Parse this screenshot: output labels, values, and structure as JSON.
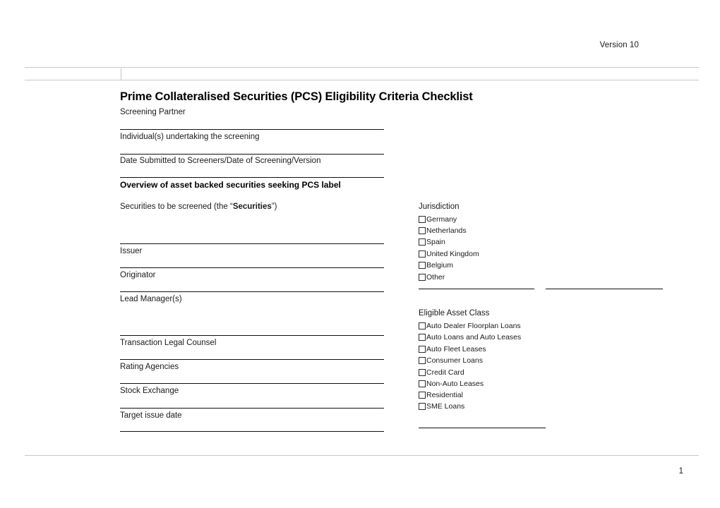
{
  "header": {
    "version": "Version 10",
    "table_cell_left": "",
    "table_cell_right": ""
  },
  "title": {
    "main": "Prime Collateralised Securities (PCS) Eligibility Criteria Checklist",
    "sub": "Screening Partner"
  },
  "left_fields": [
    {
      "label": "Individual(s) undertaking the screening",
      "bold": false
    },
    {
      "label": "Date Submitted to Screeners/Date of Screening/Version",
      "bold": false
    },
    {
      "label": "Overview of asset backed securities seeking PCS label",
      "bold": true
    },
    {
      "label": "Securities to be screened (the “Securities”)",
      "bold": false
    },
    {
      "label": "Issuer",
      "bold": false
    },
    {
      "label": "Originator",
      "bold": false
    },
    {
      "label": "Lead Manager(s)",
      "bold": false
    },
    {
      "label": "Transaction Legal Counsel",
      "bold": false
    },
    {
      "label": "Rating Agencies",
      "bold": false
    },
    {
      "label": "Stock Exchange",
      "bold": false
    },
    {
      "label": "Target issue date",
      "bold": false
    }
  ],
  "securities_label_parts": {
    "prefix": "Securities to be screened (the “",
    "emphasis": "Securities",
    "suffix": "”)"
  },
  "jurisdiction": {
    "title": "Jurisdiction",
    "options": [
      "Germany",
      "Netherlands",
      "Spain",
      "United Kingdom",
      "Belgium",
      "Other"
    ]
  },
  "eligible_asset_class": {
    "title": "Eligible Asset Class",
    "options": [
      "Auto Dealer Floorplan Loans",
      "Auto Loans and Auto Leases",
      "Auto Fleet Leases",
      "Consumer Loans",
      "Credit Card",
      "Non-Auto Leases",
      "Residential",
      "SME Loans"
    ]
  },
  "footer": {
    "page_number": "1"
  },
  "colors": {
    "rule_dark": "#101010",
    "rule_light": "#c8c8c8",
    "text": "#1a1a1a"
  }
}
